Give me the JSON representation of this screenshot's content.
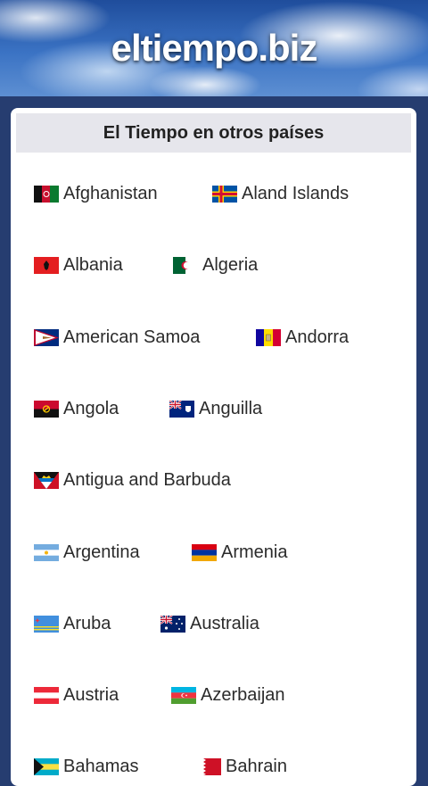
{
  "header": {
    "site_title": "eltiempo.biz"
  },
  "card": {
    "title": "El Tiempo en otros países"
  },
  "countries": [
    {
      "name": "Afghanistan",
      "flag": "afghanistan-flag"
    },
    {
      "name": "Aland Islands",
      "flag": "aland-islands-flag"
    },
    {
      "name": "Albania",
      "flag": "albania-flag"
    },
    {
      "name": "Algeria",
      "flag": "algeria-flag"
    },
    {
      "name": "American Samoa",
      "flag": "american-samoa-flag"
    },
    {
      "name": "Andorra",
      "flag": "andorra-flag"
    },
    {
      "name": "Angola",
      "flag": "angola-flag"
    },
    {
      "name": "Anguilla",
      "flag": "anguilla-flag"
    },
    {
      "name": "Antigua and Barbuda",
      "flag": "antigua-and-barbuda-flag"
    },
    {
      "name": "Argentina",
      "flag": "argentina-flag"
    },
    {
      "name": "Armenia",
      "flag": "armenia-flag"
    },
    {
      "name": "Aruba",
      "flag": "aruba-flag"
    },
    {
      "name": "Australia",
      "flag": "australia-flag"
    },
    {
      "name": "Austria",
      "flag": "austria-flag"
    },
    {
      "name": "Azerbaijan",
      "flag": "azerbaijan-flag"
    },
    {
      "name": "Bahamas",
      "flag": "bahamas-flag"
    },
    {
      "name": "Bahrain",
      "flag": "bahrain-flag"
    }
  ],
  "colors": {
    "page_background": "#263d70",
    "card_title_background": "#e6e6ec",
    "text": "#2b2b2b"
  }
}
